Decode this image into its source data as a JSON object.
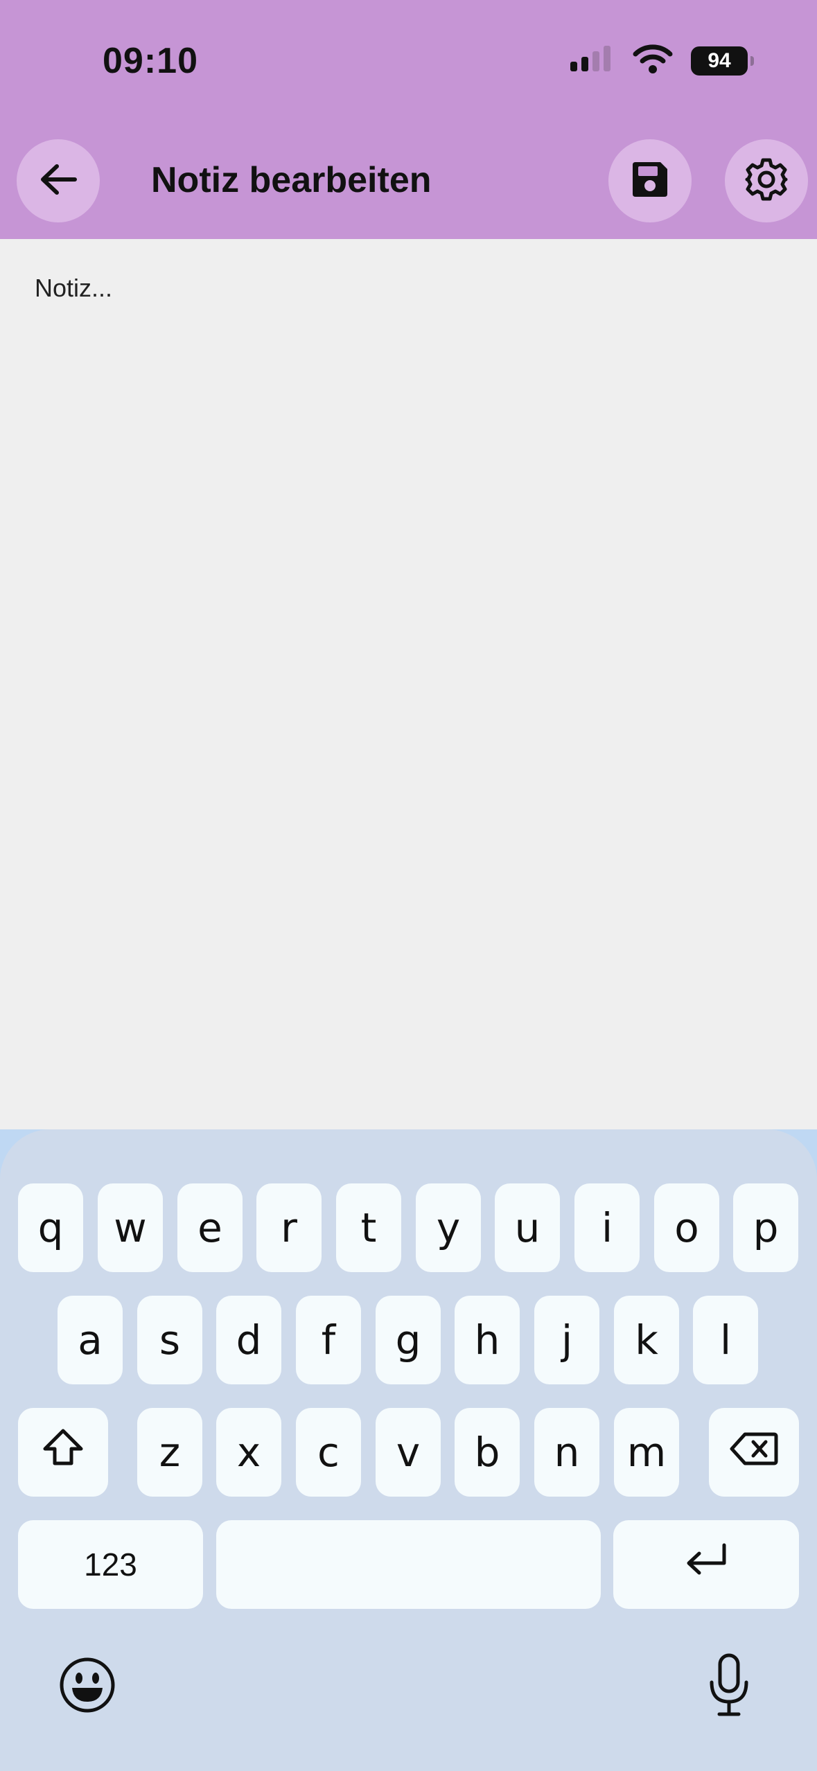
{
  "status": {
    "time": "09:10",
    "battery": "94"
  },
  "appbar": {
    "title": "Notiz bearbeiten"
  },
  "editor": {
    "placeholder": "Notiz..."
  },
  "keyboard": {
    "row1": [
      "q",
      "w",
      "e",
      "r",
      "t",
      "y",
      "u",
      "i",
      "o",
      "p"
    ],
    "row2": [
      "a",
      "s",
      "d",
      "f",
      "g",
      "h",
      "j",
      "k",
      "l"
    ],
    "row3": [
      "z",
      "x",
      "c",
      "v",
      "b",
      "n",
      "m"
    ],
    "numbers_label": "123"
  },
  "colors": {
    "appbar": "#c695d5",
    "button_bg": "#dbb6e5",
    "editor_bg": "#efefef",
    "keyboard_bg": "#cedaeb",
    "key_bg": "#f5fbfd"
  }
}
